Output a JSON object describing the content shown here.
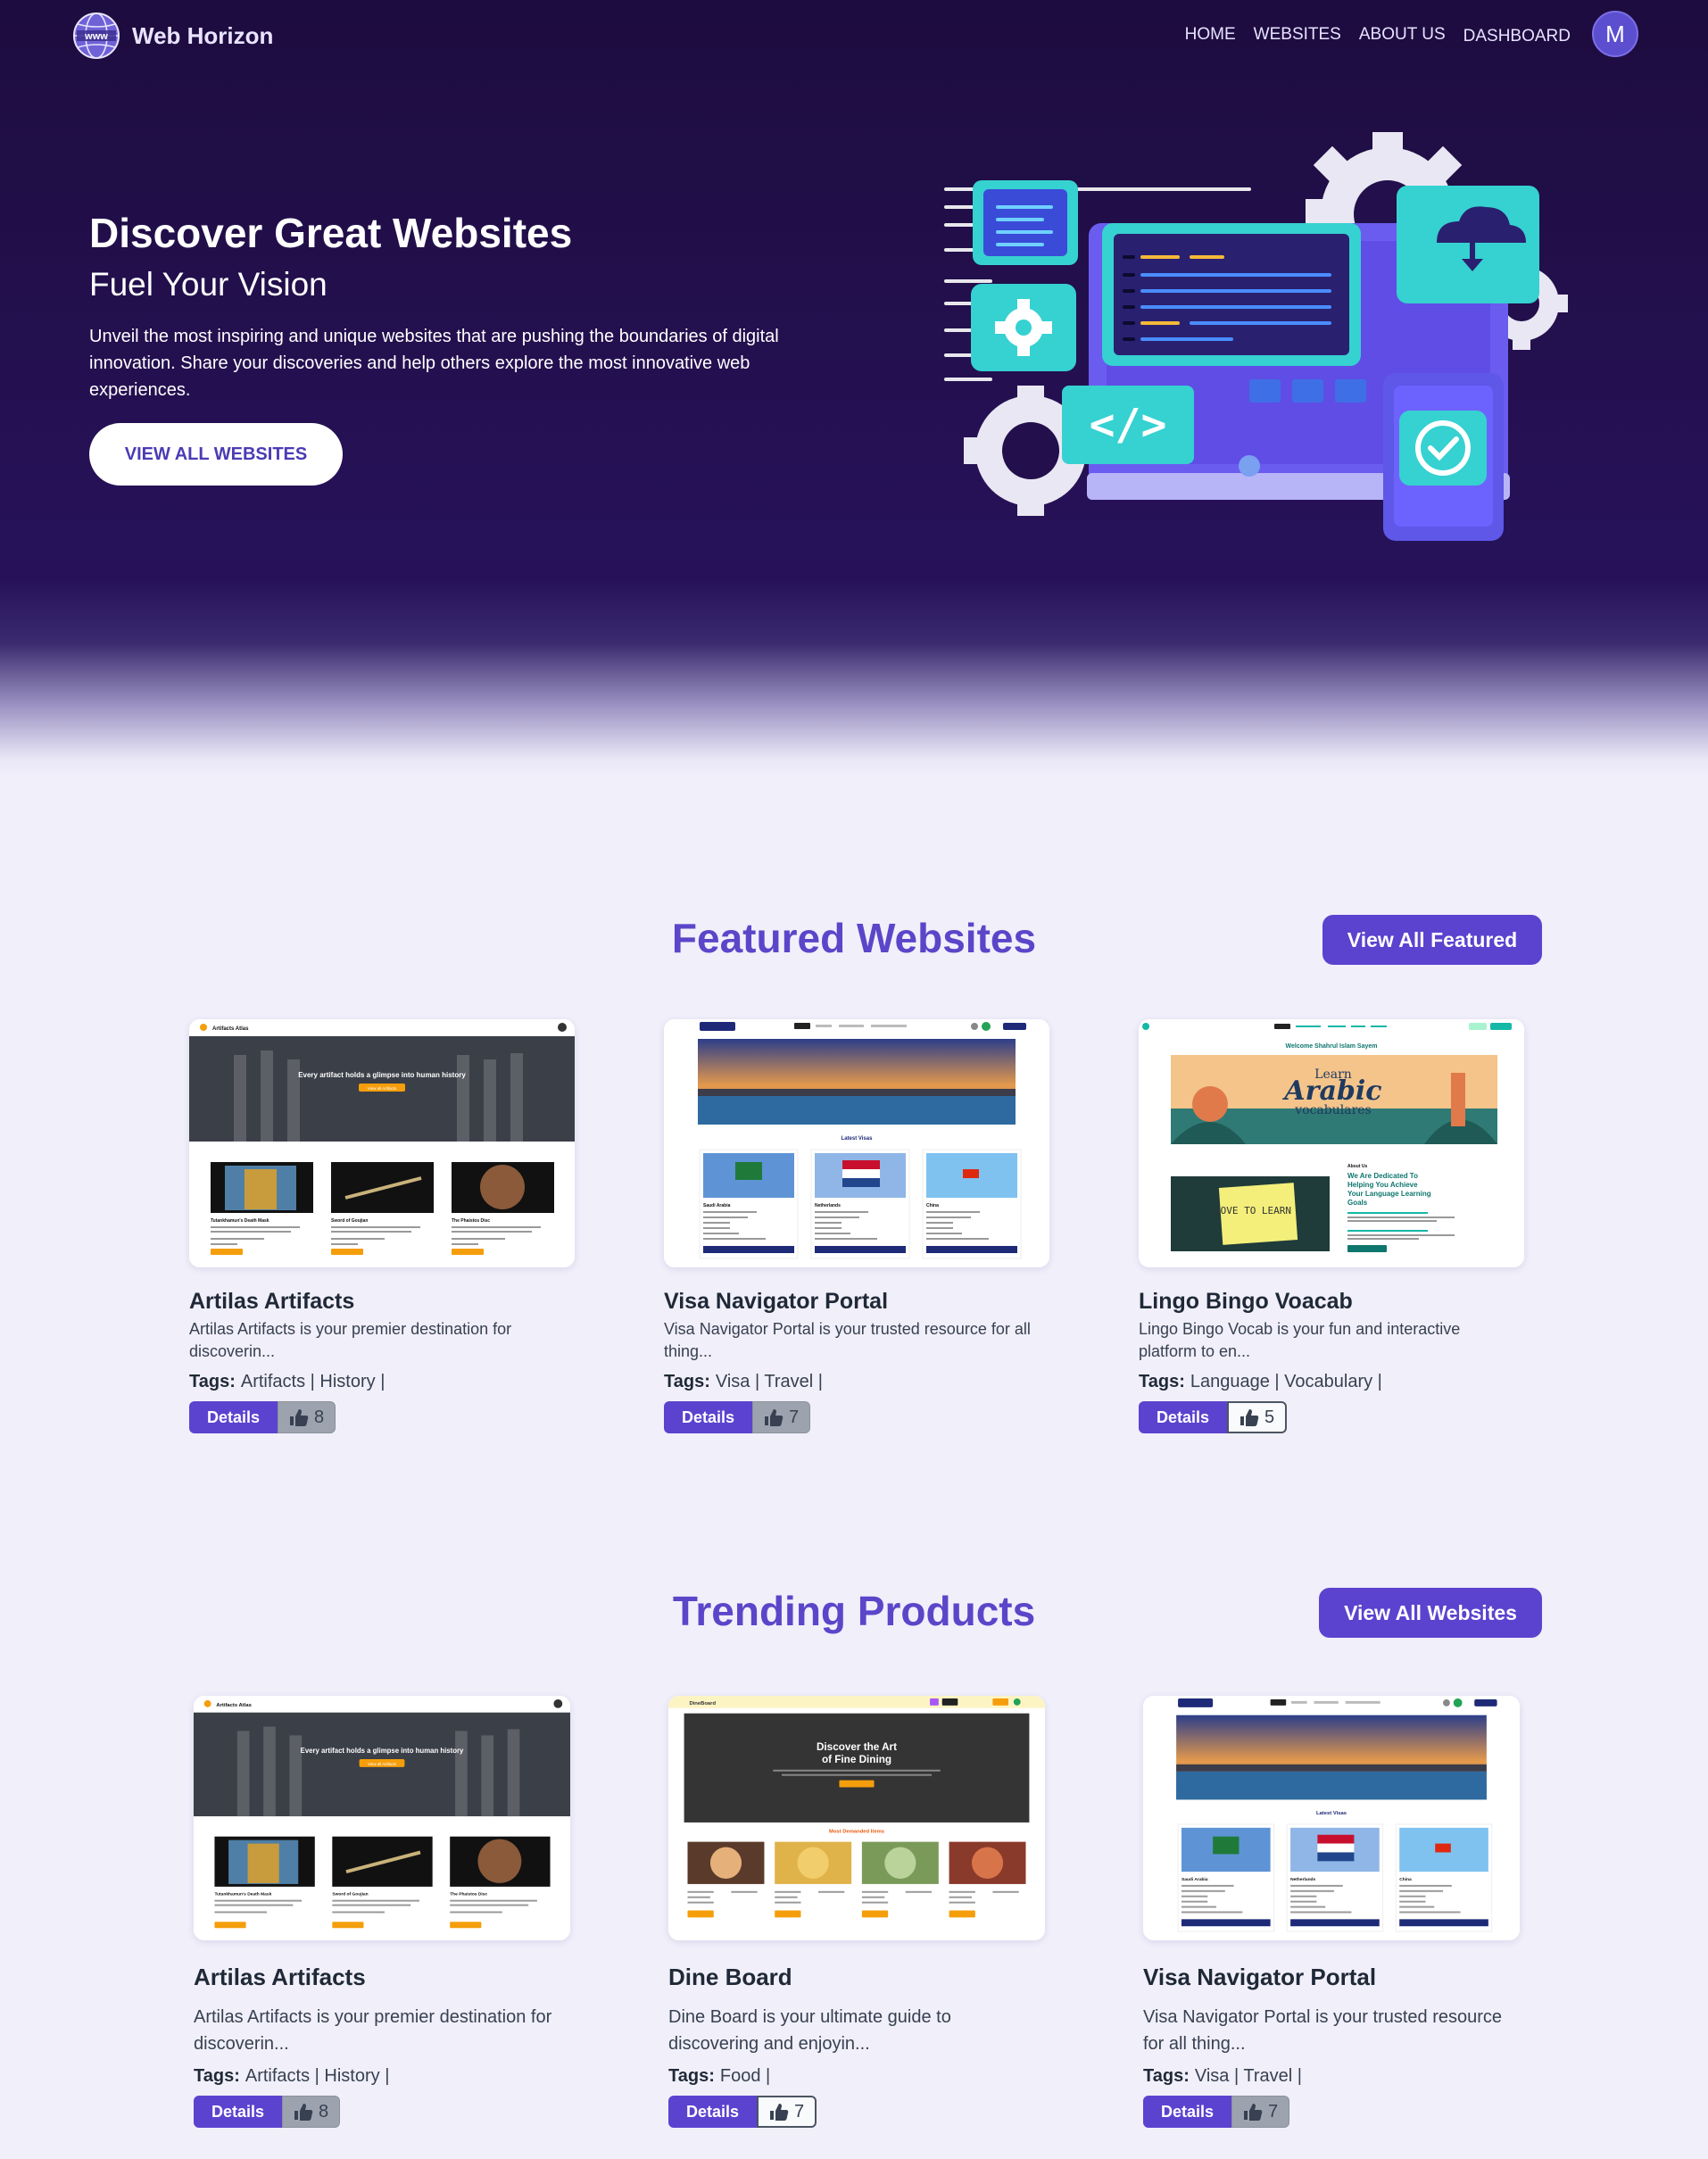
{
  "nav": {
    "brand": "Web Horizon",
    "links": [
      "HOME",
      "WEBSITES",
      "ABOUT US",
      "DASHBOARD"
    ],
    "avatar_initial": "M"
  },
  "hero": {
    "title": "Discover Great Websites",
    "subtitle": "Fuel Your Vision",
    "description": "Unveil the most inspiring and unique websites that are pushing the boundaries of digital innovation. Share your discoveries and help others explore the most innovative web experiences.",
    "cta": "VIEW ALL WEBSITES"
  },
  "featured": {
    "title": "Featured Websites",
    "button": "View All Featured",
    "cards": [
      {
        "title": "Artilas Artifacts",
        "description": "Artilas Artifacts is your premier destination for discoverin...",
        "tags_label": "Tags:",
        "tags": "Artifacts | History |",
        "details": "Details",
        "likes": "8",
        "likes_style": "grey",
        "thumb": "artifacts"
      },
      {
        "title": "Visa Navigator Portal",
        "description": "Visa Navigator Portal is your trusted resource for all thing...",
        "tags_label": "Tags:",
        "tags": "Visa | Travel |",
        "details": "Details",
        "likes": "7",
        "likes_style": "grey",
        "thumb": "visa"
      },
      {
        "title": "Lingo Bingo Voacab",
        "description": "Lingo Bingo Vocab is your fun and interactive platform to en...",
        "tags_label": "Tags:",
        "tags": "Language | Vocabulary |",
        "details": "Details",
        "likes": "5",
        "likes_style": "white",
        "thumb": "lingo"
      }
    ]
  },
  "trending": {
    "title": "Trending Products",
    "button": "View All Websites",
    "cards": [
      {
        "title": "Artilas Artifacts",
        "description": "Artilas Artifacts is your premier destination for discoverin...",
        "tags_label": "Tags:",
        "tags": "Artifacts | History |",
        "details": "Details",
        "likes": "8",
        "likes_style": "grey",
        "thumb": "artifacts"
      },
      {
        "title": "Dine Board",
        "description": "Dine Board is your ultimate guide to discovering and enjoyin...",
        "tags_label": "Tags:",
        "tags": "Food |",
        "details": "Details",
        "likes": "7",
        "likes_style": "white",
        "thumb": "dine"
      },
      {
        "title": "Visa Navigator Portal",
        "description": "Visa Navigator Portal is your trusted resource for all thing...",
        "tags_label": "Tags:",
        "tags": "Visa | Travel |",
        "details": "Details",
        "likes": "7",
        "likes_style": "grey",
        "thumb": "visa"
      }
    ]
  },
  "thumbnails": {
    "artifacts": {
      "site": "Artifacts Atlas",
      "banner": "Every artifact holds a glimpse into human history",
      "banner_btn": "View all Artifacts",
      "items": [
        "Tutankhamun's Death Mask",
        "Sword of Goujian",
        "The Phaistos Disc"
      ],
      "item_btn": "View Details"
    },
    "visa": {
      "section": "Latest Visas",
      "items": [
        "Saudi Arabia",
        "Netherlands",
        "China"
      ],
      "item_btn": "See Details"
    },
    "lingo": {
      "welcome": "Welcome Shahrul Islam Sayem",
      "banner_top": "Learn",
      "banner_main": "Arabic",
      "banner_sub": "vocabulares",
      "card_text": "LOVE TO LEARN",
      "about": "About Us",
      "headline": "We Are Dedicated To Helping You Achieve Your Language Learning Goals",
      "btn": "Learn More"
    },
    "dine": {
      "site": "DineBoard",
      "banner": "Discover the Art of Fine Dining",
      "banner_btn": "Explore Foods",
      "section": "Most Demanded Items",
      "item_btn": "View Details"
    }
  },
  "colors": {
    "accent": "#5b43cf",
    "section_title": "#5b46c9",
    "hero_bg": "#220f4b",
    "page_bg": "#f1effa"
  }
}
